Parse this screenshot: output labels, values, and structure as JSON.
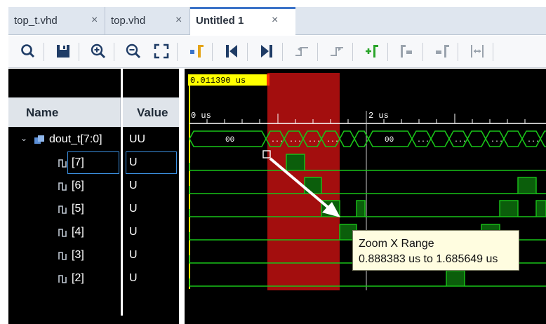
{
  "tabs": [
    {
      "label": "top_t.vhd",
      "close": "×"
    },
    {
      "label": "top.vhd",
      "close": "×"
    },
    {
      "label": "Untitled 1",
      "close": "×"
    }
  ],
  "toolbar": {
    "buttons": [
      "search-icon",
      "save-icon",
      "zoom-in-icon",
      "zoom-out-icon",
      "zoom-fit-icon",
      "go-to-cursor-icon",
      "go-to-start-icon",
      "go-to-end-icon",
      "previous-transition-icon",
      "next-transition-icon",
      "add-marker-icon",
      "previous-marker-icon",
      "next-marker-icon",
      "swap-cursors-icon"
    ]
  },
  "columns": {
    "name": "Name",
    "value": "Value"
  },
  "signals": [
    {
      "name": "dout_t[7:0]",
      "value": "UU"
    },
    {
      "name": "[7]",
      "value": "U"
    },
    {
      "name": "[6]",
      "value": "U"
    },
    {
      "name": "[5]",
      "value": "U"
    },
    {
      "name": "[4]",
      "value": "U"
    },
    {
      "name": "[3]",
      "value": "U"
    },
    {
      "name": "[2]",
      "value": "U"
    }
  ],
  "waveform": {
    "cursor_time": "0.011390 us",
    "ruler": [
      "0 us",
      "2 us"
    ],
    "bus_values": [
      "00",
      "...",
      "...",
      "...",
      "...",
      "00",
      "...",
      "...",
      "...",
      "..."
    ]
  },
  "tooltip": {
    "title": "Zoom X Range",
    "range": "0.888383 us to 1.685649 us"
  },
  "colors": {
    "wave": "#19c419",
    "cursor": "#ffff00",
    "zoom_region": "#b10f0f"
  }
}
